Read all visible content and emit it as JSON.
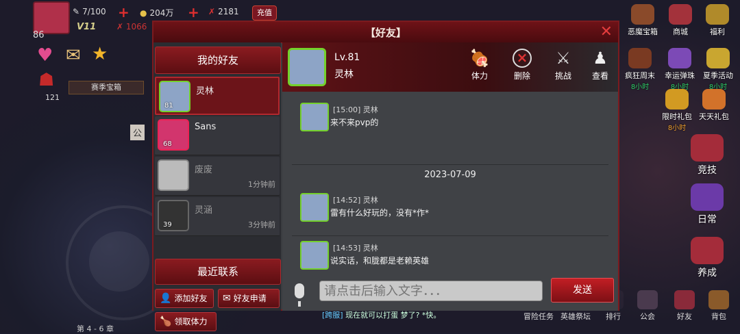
{
  "hud": {
    "level": "86",
    "stamina": "7/100",
    "gold": "204万",
    "gems": "2181",
    "charge": "充值",
    "vip": "V11",
    "power": "1066",
    "season_box": "赛季宝箱",
    "season_count": "121",
    "notice_sign": "公",
    "chapter": "第 4 - 6 章"
  },
  "bottom_chat": {
    "channel": "[跨服]",
    "text": "现在就可以打蛋 梦了? *快。"
  },
  "right_menu": {
    "top": [
      "恶魔宝箱",
      "商城",
      "福利"
    ],
    "row2": [
      "疯狂周末",
      "幸运弹珠",
      "夏季活动"
    ],
    "timers": [
      "8小时",
      "8小时",
      "8小时"
    ],
    "row3": [
      "限时礼包",
      "天天礼包"
    ],
    "row3_timer": "8小时",
    "big": [
      "竞技",
      "日常",
      "养成"
    ],
    "bottom_nav": [
      "冒险任务",
      "英雄祭坛",
      "排行",
      "公会",
      "好友",
      "背包"
    ]
  },
  "dialog": {
    "title": "【好友】",
    "close": "✕",
    "tab_friends": "我的好友",
    "tab_recent": "最近联系",
    "friends": [
      {
        "name": "灵林",
        "level": "81",
        "time": "",
        "selected": true,
        "online": true
      },
      {
        "name": "Sans",
        "level": "68",
        "time": "",
        "selected": false,
        "online": true
      },
      {
        "name": "废废",
        "level": "",
        "time": "1分钟前",
        "selected": false,
        "online": false
      },
      {
        "name": "灵涵",
        "level": "39",
        "time": "3分钟前",
        "selected": false,
        "online": false
      }
    ],
    "buttons": {
      "add_friend": "添加好友",
      "friend_request": "好友申请",
      "claim_stamina": "领取体力"
    },
    "profile": {
      "level": "Lv.81",
      "name": "灵林"
    },
    "actions": [
      "体力",
      "删除",
      "挑战",
      "查看"
    ],
    "messages": [
      {
        "time": "[15:00]",
        "sender": "灵林",
        "text": "来不来pvp的"
      },
      {
        "time": "[14:52]",
        "sender": "灵林",
        "text": "雷有什么好玩的，没有*作*"
      },
      {
        "time": "[14:53]",
        "sender": "灵林",
        "text": "说实话，和胧都是老赖英雄"
      }
    ],
    "date_separator": "2023-07-09",
    "input_placeholder": "请点击后输入文字．．．",
    "send": "发送"
  }
}
